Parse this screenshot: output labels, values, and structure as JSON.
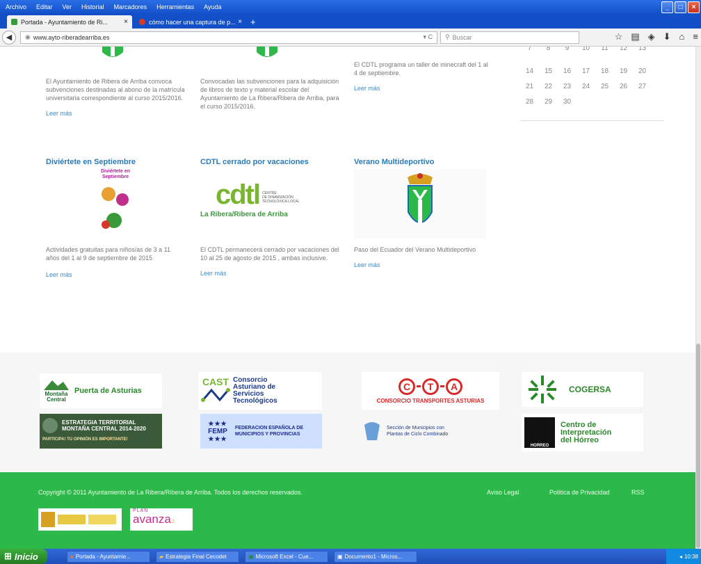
{
  "menubar": {
    "items": [
      "Archivo",
      "Editar",
      "Ver",
      "Historial",
      "Marcadores",
      "Herramientas",
      "Ayuda"
    ]
  },
  "tabs": [
    {
      "label": "Portada - Ayuntamiento de Ri...",
      "active": true
    },
    {
      "label": "cómo hacer una captura de p...",
      "active": false
    }
  ],
  "nav": {
    "url": "www.ayto-riberadearriba.es",
    "search_placeholder": "Buscar"
  },
  "posts_top": [
    {
      "text": "El Ayuntamiento de Ribera de Arriba convoca subvenciones destinadas al abono de la matrícula universitaria correspondiente al curso 2015/2016.",
      "more": "Leer más"
    },
    {
      "text": "Convocadas las subvenciones para la adquisición de libros de texto y material escolar del Ayuntamiento de La Ribera/Ribera de Arriba, para el curso 2015/2016.",
      "more": ""
    },
    {
      "text": "El CDTL programa un taller de minecraft del 1 al 4 de septiembre.",
      "more": "Leer más"
    }
  ],
  "calendar": {
    "rows": [
      [
        "7",
        "8",
        "9",
        "10",
        "11",
        "12",
        "13"
      ],
      [
        "14",
        "15",
        "16",
        "17",
        "18",
        "19",
        "20"
      ],
      [
        "21",
        "22",
        "23",
        "24",
        "25",
        "26",
        "27"
      ],
      [
        "28",
        "29",
        "30",
        "",
        "",
        "",
        ""
      ]
    ]
  },
  "posts_mid": [
    {
      "title": "Diviértete en Septiembre",
      "logo_l1": "Diviértete en",
      "logo_l2": "Septiembre",
      "text": "Actividades gratuitas para niños/as de 3 a 11 años del 1 al 9 de septiembre de 2015",
      "more": "Leer más"
    },
    {
      "title": "CDTL cerrado por vacaciones",
      "logo_main": "cdtl",
      "logo_side1": "CENTRE",
      "logo_side2": "DE DINAMIZACIÓN",
      "logo_side3": "TECNOLÓXICA LOCAL",
      "logo_sub": "La Ribera/Ribera de Arriba",
      "text": "El CDTL permanecerá cerrado por vacaciones del 10 al 25 de agosto de 2015 , ambas inclusive.",
      "more": "Leer más"
    },
    {
      "title": "Verano Multideportivo",
      "text": "Paso del Ecuador del Verano Multideportivo",
      "more": "Leer más"
    }
  ],
  "partners": {
    "puerta": "Puerta de Asturias",
    "montana_l1": "Montaña",
    "montana_l2": "Central",
    "cast_abbr": "CAST",
    "cast_l1": "Consorcio",
    "cast_l2": "Asturiano de",
    "cast_l3": "Servicios",
    "cast_l4": "Tecnológicos",
    "cta_letters": [
      "C",
      "T",
      "A"
    ],
    "cta_name": "CONSORCIO TRANSPORTES ASTURIAS",
    "cogersa": "COGERSA",
    "estrategia_l1": "ESTRATEGIA TERRITORIAL",
    "estrategia_l2": "MONTAÑA CENTRAL 2014-2020",
    "estrategia_l3": "PARTICIPA! TU OPINIÓN ES IMPORTANTE!",
    "femp_abbr": "FEMP",
    "femp_l1": "FEDERACION ESPAÑOLA DE",
    "femp_l2": "MUNICIPIOS Y PROVINCIAS",
    "seccion_l1": "Sección de Municipios con",
    "seccion_l2": "Plantas de Ciclo Combinado",
    "horreo_l1": "Centro de",
    "horreo_l2": "Interpretación",
    "horreo_l3": "del Hórreo",
    "horreo_tag": "HORREO"
  },
  "footer": {
    "copyright": "Copyright © 2011 Ayuntamiento de La Ribera/Ribera de Arriba. Todos los derechos reservados.",
    "links": [
      "Aviso Legal",
      "Política de Privacidad",
      "RSS"
    ],
    "plan_l1": "PLAN",
    "plan_l2": "avanza",
    "plan_suffix": "2"
  },
  "taskbar": {
    "start": "Inicio",
    "tasks": [
      "Portada - Ayuntamie...",
      "Estrategia Final Cecodet",
      "Microsoft Excel - Cue...",
      "Documento1 - Micros..."
    ],
    "clock": "10:38"
  },
  "colors": {
    "link": "#2a7ab8",
    "footer_green": "#2db84a",
    "taskbar": "#1f4fb8"
  }
}
